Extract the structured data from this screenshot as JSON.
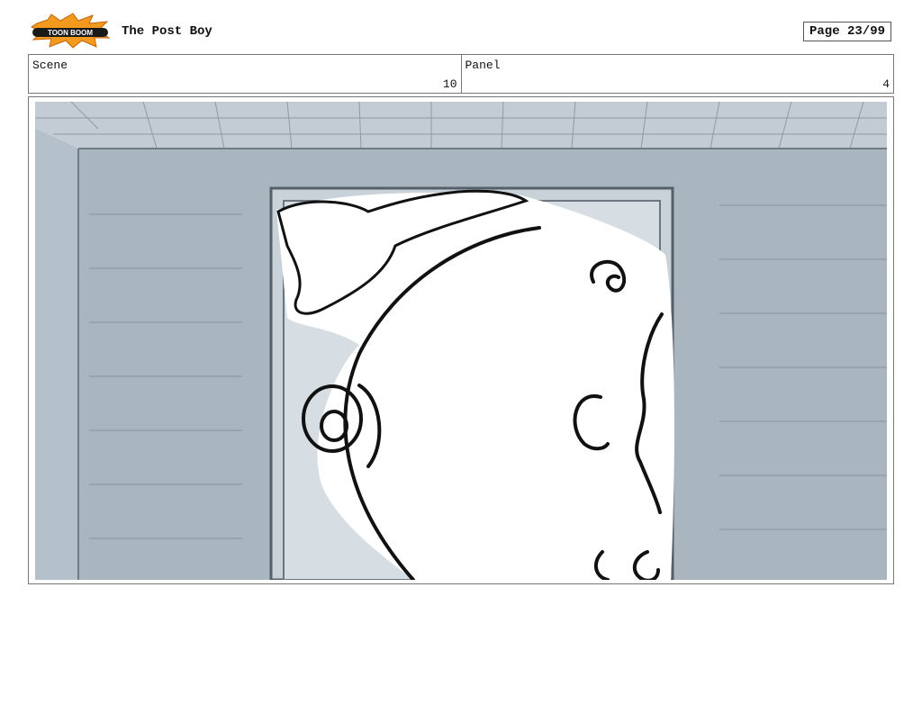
{
  "header": {
    "logo_text": "TOON BOOM",
    "title": "The Post Boy",
    "page": "Page 23/99"
  },
  "info": {
    "scene_label": "Scene",
    "scene_value": "10",
    "panel_label": "Panel",
    "panel_value": "4"
  },
  "colors": {
    "wall": "#a9b6c0",
    "ceiling": "#c5ced6",
    "line": "#111111",
    "logo_orange": "#f39a1e"
  },
  "drawing": {
    "description_icon": "storyboard-sketch"
  }
}
